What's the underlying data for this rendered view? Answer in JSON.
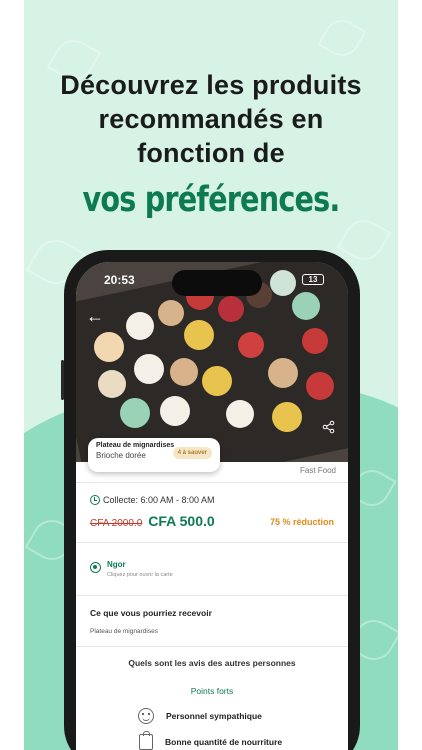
{
  "headline": {
    "lines": [
      "Découvrez les produits",
      "recommandés en",
      "fonction de"
    ],
    "accent": "vos préférences."
  },
  "colors": {
    "brand_green": "#0d7a52",
    "background_mint": "#d6f3e6",
    "discount_orange": "#e08a1a",
    "old_price_red": "#c0392b"
  },
  "phone": {
    "status": {
      "time": "20:53",
      "battery": "13"
    },
    "hero_image": "pastry-tray-macarons-mignardises",
    "product": {
      "title": "Plateau de mignardises",
      "store": "Brioche dorée",
      "remaining_badge": "4 à sauver",
      "category": "Fast Food"
    },
    "pickup": {
      "label": "Collecte: 6:00 AM - 8:00 AM"
    },
    "price": {
      "old": "CFA 2000.0",
      "new": "CFA 500.0",
      "discount": "75 % réduction"
    },
    "location": {
      "name": "Ngor",
      "hint": "Cliquez pour ouvrir la carte"
    },
    "receive": {
      "title": "Ce que vous pourriez recevoir",
      "item": "Plateau de mignardises"
    },
    "reviews": {
      "title": "Quels sont les avis des autres personnes",
      "strengths_title": "Points forts",
      "strengths": [
        {
          "label": "Personnel sympathique",
          "icon": "smile-icon"
        },
        {
          "label": "Bonne quantité de nourriture",
          "icon": "bag-icon"
        }
      ]
    }
  }
}
